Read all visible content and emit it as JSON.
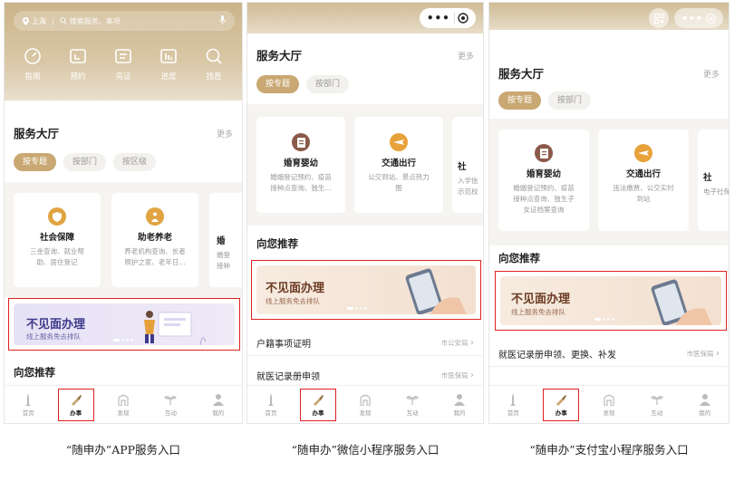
{
  "colors": {
    "gold": "#c9a873",
    "highlight": "#e02020"
  },
  "app": {
    "search": {
      "location": "上海",
      "placeholder": "搜索服务、事项"
    },
    "quick": [
      {
        "label": "指南",
        "icon": "compass-icon"
      },
      {
        "label": "预约",
        "icon": "calendar-icon"
      },
      {
        "label": "亮证",
        "icon": "id-card-icon"
      },
      {
        "label": "进度",
        "icon": "progress-icon"
      },
      {
        "label": "找茬",
        "icon": "search-icon"
      }
    ],
    "section_title": "服务大厅",
    "more": "更多",
    "tabs": [
      "按专题",
      "按部门",
      "按区级"
    ],
    "cards": [
      {
        "title": "社会保障",
        "desc1": "三金查询、就业帮",
        "desc2": "助、居住登记"
      },
      {
        "title": "助老养老",
        "desc1": "养老机构查询、长者",
        "desc2": "照护之家、老年日..."
      },
      {
        "title": "婚",
        "desc1": "婚登",
        "desc2": "接种"
      }
    ],
    "banner": {
      "title": "不见面办理",
      "subtitle": "线上服务免去排队"
    },
    "recommend": "向您推荐",
    "tabbar": [
      "首页",
      "办事",
      "发现",
      "互动",
      "我的"
    ]
  },
  "wechat": {
    "section_title": "服务大厅",
    "more": "更多",
    "tabs": [
      "按专题",
      "按部门"
    ],
    "cards": [
      {
        "title": "婚育婴幼",
        "desc1": "婚姻登记预约、疫苗",
        "desc2": "接种点查询、独生..."
      },
      {
        "title": "交通出行",
        "desc1": "公交到站、景点热力",
        "desc2": "图"
      },
      {
        "title": "社",
        "desc1": "入学信",
        "desc2": "示范校"
      }
    ],
    "recommend": "向您推荐",
    "banner": {
      "title": "不见面办理",
      "subtitle": "线上服务免去排队"
    },
    "list": [
      {
        "title": "户籍事项证明",
        "dept": "市公安局"
      },
      {
        "title": "就医记录册申领",
        "dept": "市医保局"
      }
    ],
    "tabbar": [
      "首页",
      "办事",
      "发现",
      "互动",
      "我的"
    ]
  },
  "alipay": {
    "section_title": "服务大厅",
    "more": "更多",
    "tabs": [
      "按专题",
      "按部门"
    ],
    "cards": [
      {
        "title": "婚育婴幼",
        "desc1": "婚姻登记预约、疫苗",
        "desc2": "接种点查询、独生子",
        "desc3": "女证档案查询"
      },
      {
        "title": "交通出行",
        "desc1": "违法缴费、公交实时",
        "desc2": "到站",
        "desc3": ""
      },
      {
        "title": "社",
        "desc1": "电子社保",
        "desc2": "",
        "desc3": ""
      }
    ],
    "recommend": "向您推荐",
    "banner": {
      "title": "不见面办理",
      "subtitle": "线上服务免去排队"
    },
    "list": [
      {
        "title": "就医记录册申领、更换、补发",
        "dept": "市医保局"
      }
    ],
    "tabbar": [
      "首页",
      "办事",
      "发现",
      "互动",
      "我的"
    ]
  },
  "captions": [
    "“随申办”APP服务入口",
    "“随申办”微信小程序服务入口",
    "“随申办”支付宝小程序服务入口"
  ]
}
